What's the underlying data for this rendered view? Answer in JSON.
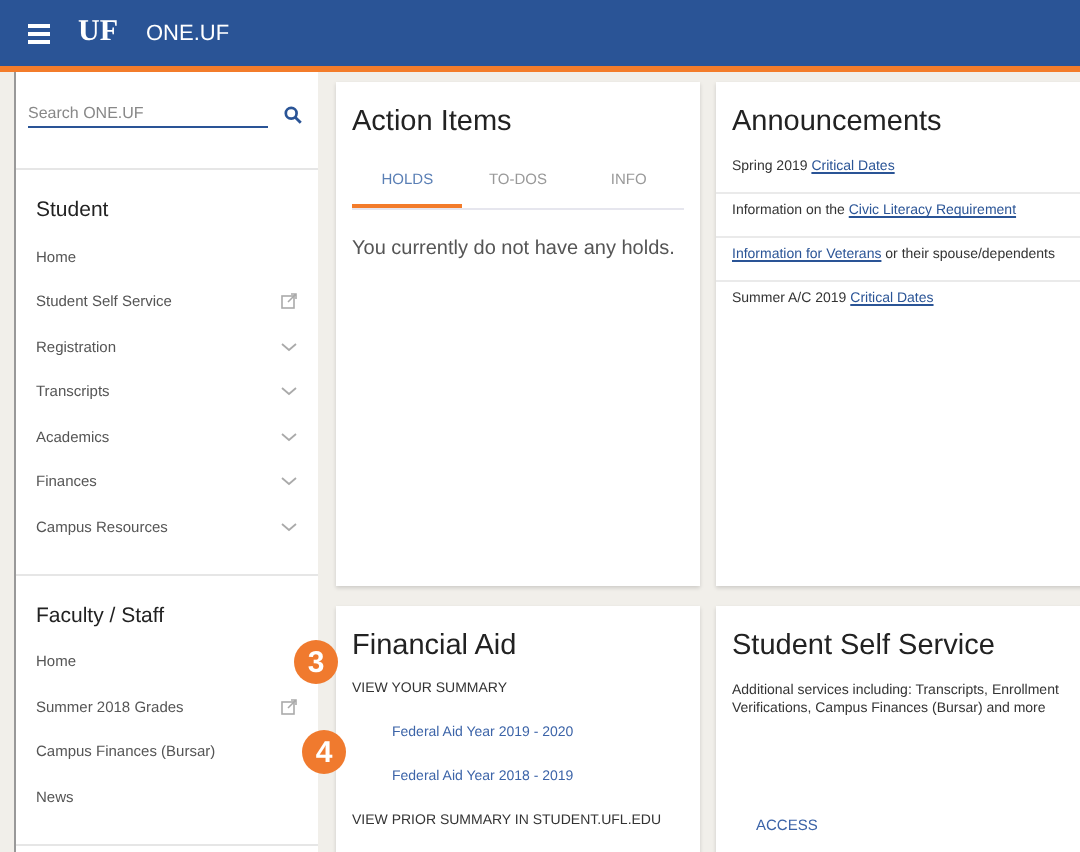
{
  "header": {
    "brand": "UF",
    "title": "ONE.UF"
  },
  "sidebar": {
    "search": {
      "placeholder": "Search ONE.UF"
    },
    "sections": [
      {
        "title": "Student",
        "items": [
          {
            "label": "Home",
            "kind": "link"
          },
          {
            "label": "Student Self Service",
            "kind": "external"
          },
          {
            "label": "Registration",
            "kind": "expandable"
          },
          {
            "label": "Transcripts",
            "kind": "expandable"
          },
          {
            "label": "Academics",
            "kind": "expandable"
          },
          {
            "label": "Finances",
            "kind": "expandable"
          },
          {
            "label": "Campus Resources",
            "kind": "expandable"
          }
        ]
      },
      {
        "title": "Faculty / Staff",
        "items": [
          {
            "label": "Home",
            "kind": "link"
          },
          {
            "label": "Summer 2018 Grades",
            "kind": "external"
          },
          {
            "label": "Campus Finances (Bursar)",
            "kind": "link"
          },
          {
            "label": "News",
            "kind": "link"
          }
        ]
      }
    ]
  },
  "action_items": {
    "title": "Action Items",
    "tabs": [
      {
        "label": "HOLDS",
        "selected": true
      },
      {
        "label": "TO-DOS",
        "selected": false
      },
      {
        "label": "INFO",
        "selected": false
      }
    ],
    "message": "You currently do not have any holds."
  },
  "announcements": {
    "title": "Announcements",
    "items": [
      {
        "before": "Spring 2019",
        "link": "Critical Dates"
      },
      {
        "before": "Information on the",
        "link": "Civic Literacy Requirement"
      },
      {
        "link": "Information for Veterans",
        "after": "or their spouse/dependents"
      },
      {
        "before": "Summer A/C 2019",
        "link": "Critical Dates"
      }
    ]
  },
  "financial_aid": {
    "title": "Financial Aid",
    "entries": [
      {
        "label": "VIEW YOUR SUMMARY",
        "kind": "heading"
      },
      {
        "label": "Federal Aid Year 2019 - 2020",
        "kind": "link"
      },
      {
        "label": "Federal Aid Year 2018 - 2019",
        "kind": "link"
      },
      {
        "label": "VIEW PRIOR SUMMARY IN STUDENT.UFL.EDU",
        "kind": "heading"
      }
    ]
  },
  "self_service": {
    "title": "Student Self Service",
    "description": "Additional services including: Transcripts, Enrollment Verifications, Campus Finances (Bursar) and more",
    "action": "ACCESS"
  },
  "step_markers": [
    "3",
    "4"
  ]
}
